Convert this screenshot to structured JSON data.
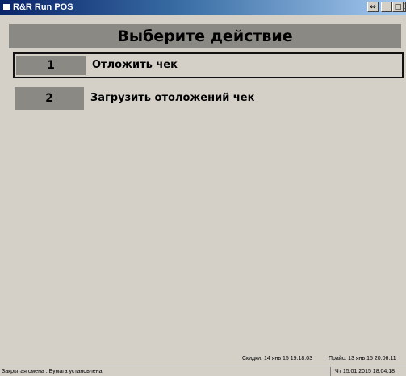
{
  "window": {
    "title": "R&R Run POS",
    "icon": "app-icon",
    "controls": {
      "restore_symbol": "⇔",
      "minimize_symbol": "_",
      "maximize_symbol": "□",
      "close_symbol": "X"
    }
  },
  "header": {
    "title": "Выберите действие"
  },
  "actions": [
    {
      "number": "1",
      "label": "Отложить чек",
      "selected": true
    },
    {
      "number": "2",
      "label": "Загрузить отоложений чек",
      "selected": false
    }
  ],
  "info": {
    "discounts": "Скидки: 14 янв 15 19:18:03",
    "prices": "Прайс: 13 янв 15 20:06:11"
  },
  "status": {
    "left": "Закрытая смена : Бумага установлена",
    "right": "Чт 15.01.2015 18:04:18"
  },
  "colors": {
    "background": "#d4d0c8",
    "header_bg": "#8a8984",
    "titlebar_start": "#0a246a",
    "titlebar_end": "#a6caf0"
  }
}
